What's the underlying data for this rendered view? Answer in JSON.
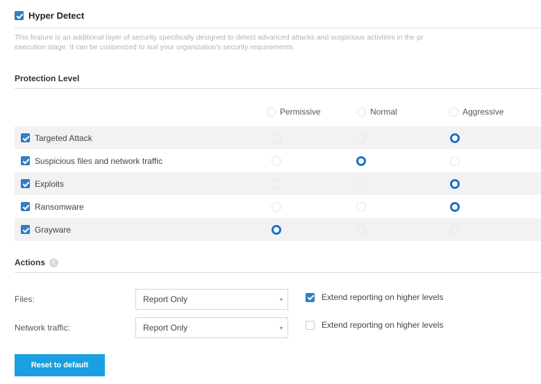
{
  "feature": {
    "title": "Hyper Detect",
    "enabled": true,
    "description_line1": "This feature is an additional layer of security specifically designed to detect advanced attacks and suspicious activities in the pr",
    "description_line2": "execution stage. It can be customized to suit your organization's security requirements."
  },
  "protection": {
    "title": "Protection Level",
    "levels": [
      "Permissive",
      "Normal",
      "Aggressive"
    ],
    "rows": [
      {
        "label": "Targeted Attack",
        "checked": true,
        "selected": "Aggressive"
      },
      {
        "label": "Suspicious files and network traffic",
        "checked": true,
        "selected": "Normal"
      },
      {
        "label": "Exploits",
        "checked": true,
        "selected": "Aggressive"
      },
      {
        "label": "Ransomware",
        "checked": true,
        "selected": "Aggressive"
      },
      {
        "label": "Grayware",
        "checked": true,
        "selected": "Permissive"
      }
    ]
  },
  "actions": {
    "title": "Actions",
    "info_icon": "info-icon",
    "files_label": "Files:",
    "files_value": "Report Only",
    "files_extend_label": "Extend reporting on higher levels",
    "files_extend_checked": true,
    "network_label": "Network traffic:",
    "network_value": "Report Only",
    "network_extend_label": "Extend reporting on higher levels",
    "network_extend_checked": false
  },
  "reset_button": "Reset to default",
  "colors": {
    "accent": "#2f80c9",
    "radio_selected": "#1d6fc0",
    "button": "#1c9fe0",
    "row_shade": "#f2f2f2"
  }
}
